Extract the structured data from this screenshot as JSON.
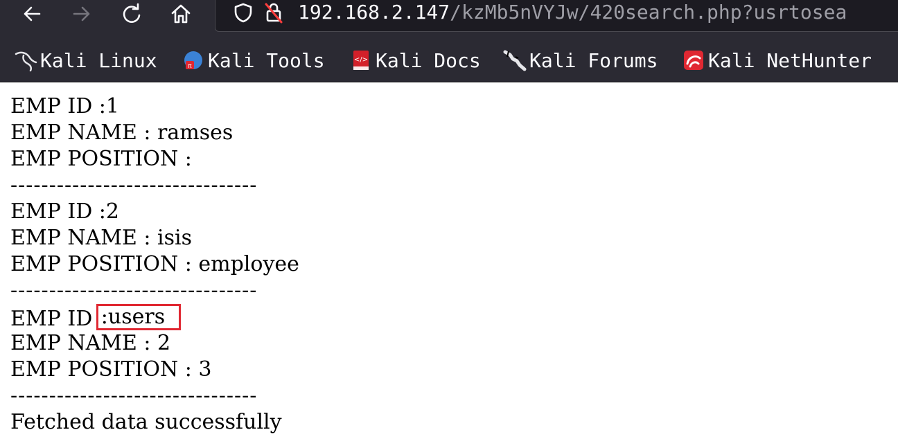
{
  "browser": {
    "url_host": "192.168.2.147",
    "url_path": "/kzMb5nVYJw/420search.php?usrtosea",
    "buttons": {
      "back": "back-icon",
      "forward": "forward-icon",
      "reload": "reload-icon",
      "home": "home-icon"
    },
    "bookmarks": [
      {
        "label": "Kali Linux",
        "icon": "kali-dragon-icon"
      },
      {
        "label": "Kali Tools",
        "icon": "kali-tools-icon"
      },
      {
        "label": "Kali Docs",
        "icon": "kali-docs-icon"
      },
      {
        "label": "Kali Forums",
        "icon": "kali-forums-icon"
      },
      {
        "label": "Kali NetHunter",
        "icon": "kali-nethunter-icon"
      }
    ],
    "colors": {
      "toolbar_bg": "#2b2a33",
      "urlbar_bg": "#1c1b22",
      "highlight_border": "#e02832"
    }
  },
  "page": {
    "records": [
      {
        "id": "EMP ID :1",
        "name": "EMP NAME : ramses",
        "position": "EMP POSITION :"
      },
      {
        "id": "EMP ID :2",
        "name": "EMP NAME : isis",
        "position": "EMP POSITION : employee"
      },
      {
        "id_prefix": "EMP ID",
        "id_value": ":users",
        "name": "EMP NAME : 2",
        "position": "EMP POSITION : 3"
      }
    ],
    "separator": "--------------------------------",
    "footer": "Fetched data successfully"
  }
}
